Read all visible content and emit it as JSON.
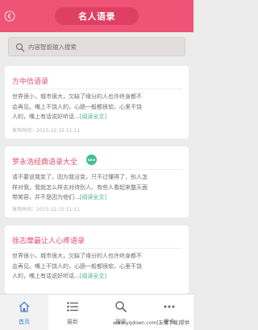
{
  "header": {
    "title": "名人语录"
  },
  "search": {
    "placeholder": "内容智能输入搜索"
  },
  "cards": [
    {
      "title": "方中信语录",
      "lines": [
        "世界很小，城市很大，欠缺了缘分的人也许终身都不",
        "会再见。嘴上不饶人的，心肠一般都很软。心里不饶",
        "人的，嘴上有话说好听话..."
      ],
      "read_more": "[阅读全文]",
      "date": "发布时间：2015-12-15  11:11"
    },
    {
      "title": "罗永浩经典语录大全",
      "badge": "NEW",
      "lines": [
        "请不要说我变了，因为我没变，只不过懂得了，别人怎",
        "样对我，我就怎么样去对待别人。有些人看起来整天面",
        "带笑容，并不是因为他们..."
      ],
      "read_more": "[阅读全文]",
      "date": "发布时间：2015-12-15  11:11"
    },
    {
      "title": "徐志摩最让人心疼语录",
      "lines": [
        "世界很小，城市很大，欠缺了缘分的人也许终身都不",
        "会再见。嘴上不饶人的，心肠一般都很软。心里不饶",
        "人的，嘴上有话说好听话..."
      ],
      "read_more": "[阅读全文]"
    }
  ],
  "tabs": [
    {
      "label": "首页",
      "icon": "home-icon",
      "active": true
    },
    {
      "label": "最新",
      "icon": "list-icon",
      "active": false
    },
    {
      "label": "搜索",
      "icon": "search-icon",
      "active": false
    },
    {
      "label": "更多",
      "icon": "more-icon",
      "active": false
    }
  ],
  "watermark": "www.yqdown.com[友情下载]提供",
  "colors": {
    "header": "#ef5476",
    "title_pill": "#de3f63",
    "card_title": "#e2506e",
    "link": "#48b08c",
    "tab_active": "#4a86c9",
    "badge": "#3fbf8d"
  }
}
